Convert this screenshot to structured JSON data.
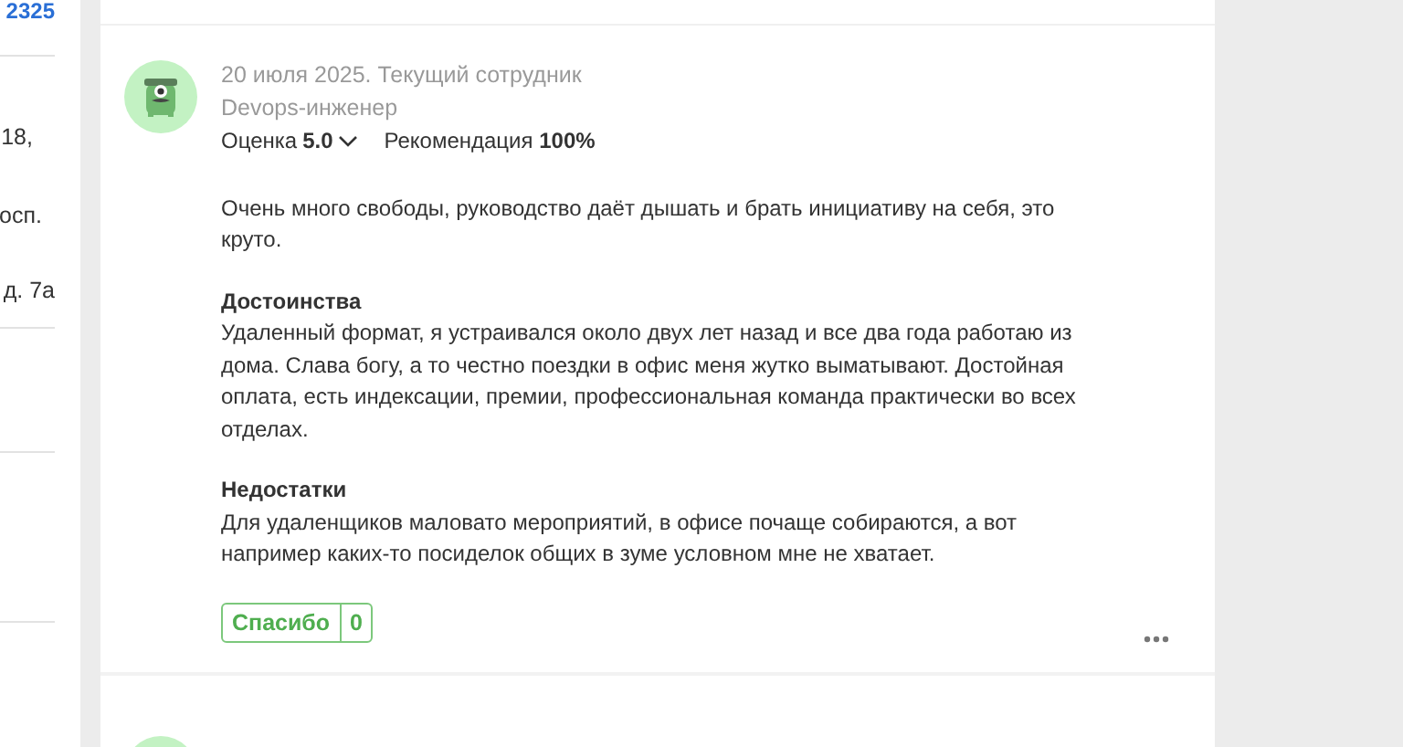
{
  "left_column": {
    "count": "2325",
    "texts": [
      "18,",
      "осп.",
      "д. 7а"
    ]
  },
  "review": {
    "meta": "20 июля 2025. Текущий сотрудник",
    "position": "Devops-инженер",
    "rating_label": "Оценка",
    "rating": "5.0",
    "recommendation_label": "Рекомендация",
    "recommendation": "100%",
    "summary": "Очень много свободы, руководство даёт дышать и брать инициативу на себя, это круто.",
    "sections": [
      {
        "title": "Достоинства",
        "text": "Удаленный формат, я устраивался около двух лет назад и все два года работаю из дома. Слава богу, а то честно поездки в офис меня жутко выматывают. Достойная оплата, есть индексации, премии, профессиональная команда практически во всех отделах."
      },
      {
        "title": "Недостатки",
        "text": "Для удаленщиков маловато мероприятий, в офисе почаще собираются, а вот например каких-то посиделок общих в зуме условном мне не хватает."
      }
    ],
    "thanks_label": "Спасибо",
    "thanks_count": "0"
  }
}
